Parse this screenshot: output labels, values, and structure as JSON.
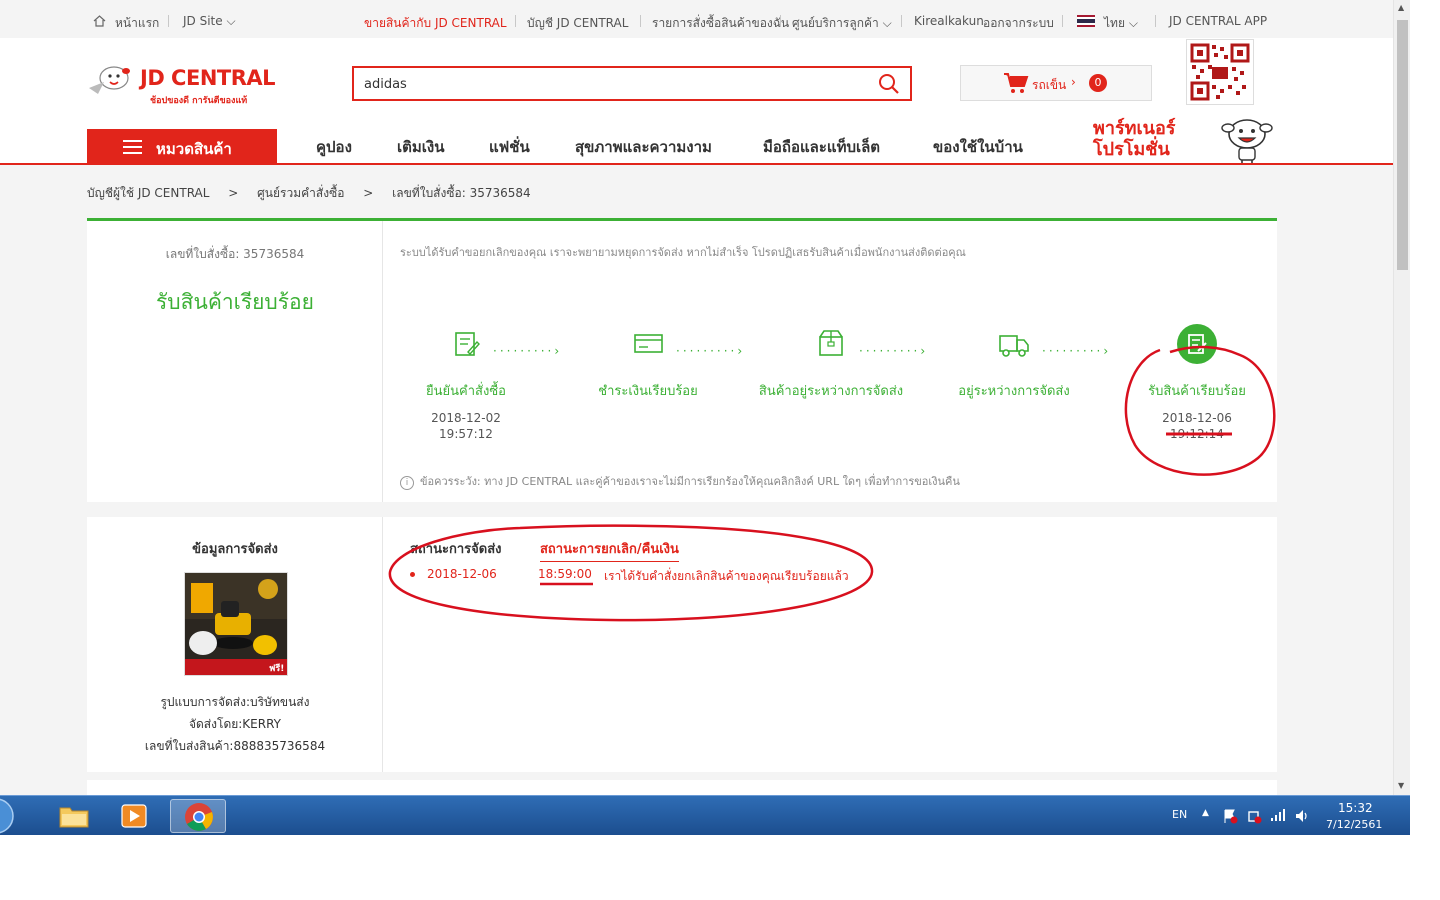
{
  "topbar": {
    "home": "หน้าแรก",
    "jd_site": "JD Site",
    "sell": "ขายสินค้ากับ JD CENTRAL",
    "account": "บัญชี JD CENTRAL",
    "orders": "รายการสั่งซื้อสินค้าของฉัน",
    "service": "ศูนย์บริการลูกค้า",
    "user": "Kirealkakun",
    "logout": "ออกจากระบบ",
    "language": "ไทย",
    "app": "JD CENTRAL APP"
  },
  "header": {
    "brand": "JD CENTRAL",
    "slogan": "ช้อปของดี การันตีของแท้",
    "search_value": "adidas",
    "cart_label": "รถเข็น",
    "cart_count": "0",
    "category_button": "หมวดสินค้า",
    "nav": [
      "คูปอง",
      "เติมเงิน",
      "แฟชั่น",
      "สุขภาพและความงาม",
      "มือถือและแท็บเล็ต",
      "ของใช้ในบ้าน"
    ],
    "promo_line1": "พาร์ทเนอร์",
    "promo_line2": "โปรโมชั่น"
  },
  "breadcrumb": {
    "items": [
      "บัญชีผู้ใช้ JD CENTRAL",
      ">",
      "ศูนย์รวมคำสั่งซื้อ",
      ">",
      "เลขที่ใบสั่งซื้อ: 35736584"
    ]
  },
  "order": {
    "number_label": "เลขที่ใบสั่งซื้อ: 35736584",
    "status": "รับสินค้าเรียบร้อย",
    "notice": "ระบบได้รับคำขอยกเลิกของคุณ เราจะพยายามหยุดการจัดส่ง หากไม่สำเร็จ โปรดปฏิเสธรับสินค้าเมื่อพนักงานส่งติดต่อคุณ",
    "steps": [
      {
        "label": "ยืนยันคำสั่งซื้อ",
        "date": "2018-12-02",
        "time": "19:57:12"
      },
      {
        "label": "ชำระเงินเรียบร้อย",
        "date": "",
        "time": ""
      },
      {
        "label": "สินค้าอยู่ระหว่างการจัดส่ง",
        "date": "",
        "time": ""
      },
      {
        "label": "อยู่ระหว่างการจัดส่ง",
        "date": "",
        "time": ""
      },
      {
        "label": "รับสินค้าเรียบร้อย",
        "date": "2018-12-06",
        "time": "19:12:14"
      }
    ],
    "tip": "ข้อควรระวัง: ทาง JD CENTRAL และคู่ค้าของเราจะไม่มีการเรียกร้องให้คุณคลิกลิงค์ URL ใดๆ เพื่อทำการขอเงินคืน"
  },
  "shipping": {
    "title": "ข้อมูลการจัดส่ง",
    "method": "รูปแบบการจัดส่ง:บริษัทขนส่ง",
    "carrier": "จัดส่งโดย:KERRY",
    "tracking": "เลขที่ใบส่งสินค้า:888835736584",
    "product_badge": "ฟรี!",
    "tabs": [
      "สถานะการจัดส่ง",
      "สถานะการยกเลิก/คืนเงิน"
    ],
    "event": {
      "date": "2018-12-06",
      "time": "18:59:00",
      "text": "เราได้รับคำสั่งยกเลิกสินค้าของคุณเรียบร้อยแล้ว"
    }
  },
  "taskbar": {
    "lang": "EN",
    "time": "15:32",
    "date": "7/12/2561"
  },
  "colors": {
    "brand_red": "#e1251b",
    "success_green": "#3cb035",
    "annotation_red": "#d8101e",
    "taskbar_blue": "#245ea5"
  },
  "icons": [
    "home-icon",
    "chevron-down-icon",
    "thailand-flag-icon",
    "search-icon",
    "cart-icon",
    "qr-code-icon",
    "menu-icon",
    "mascot-icon",
    "order-confirm-icon",
    "payment-icon",
    "package-icon",
    "truck-icon",
    "received-icon",
    "info-icon",
    "start-orb-icon",
    "explorer-icon",
    "media-player-icon",
    "chrome-icon"
  ]
}
